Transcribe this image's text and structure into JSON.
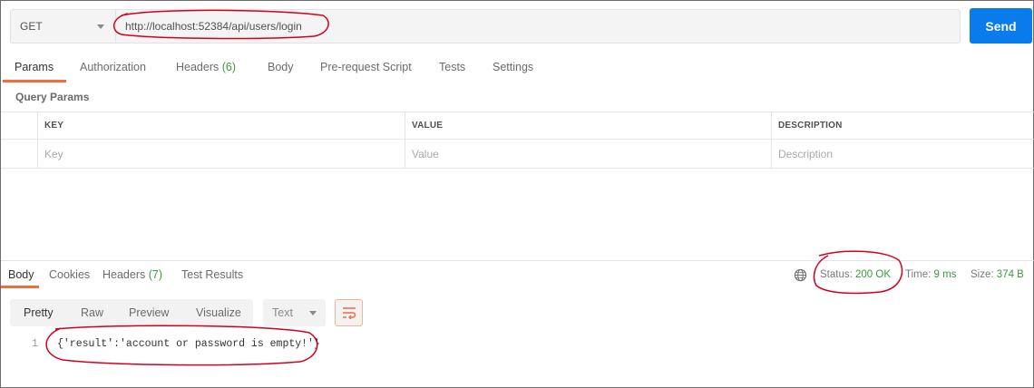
{
  "request": {
    "method": "GET",
    "url": "http://localhost:52384/api/users/login",
    "send_label": "Send"
  },
  "request_tabs": [
    {
      "label": "Params",
      "active": true
    },
    {
      "label": "Authorization"
    },
    {
      "label": "Headers",
      "count": "(6)"
    },
    {
      "label": "Body"
    },
    {
      "label": "Pre-request Script"
    },
    {
      "label": "Tests"
    },
    {
      "label": "Settings"
    }
  ],
  "query_params": {
    "title": "Query Params",
    "columns": [
      "KEY",
      "VALUE",
      "DESCRIPTION"
    ],
    "placeholders": [
      "Key",
      "Value",
      "Description"
    ]
  },
  "response_tabs": [
    {
      "label": "Body",
      "active": true
    },
    {
      "label": "Cookies"
    },
    {
      "label": "Headers",
      "count": "(7)"
    },
    {
      "label": "Test Results"
    }
  ],
  "status": {
    "status_label": "Status:",
    "status_value": "200 OK",
    "time_label": "Time:",
    "time_value": "9 ms",
    "size_label": "Size:",
    "size_value": "374 B"
  },
  "view": {
    "options": [
      "Pretty",
      "Raw",
      "Preview",
      "Visualize"
    ],
    "active": "Pretty",
    "format": "Text"
  },
  "response_body": {
    "line_number": "1",
    "content": "{'result':'account or password is empty!'}"
  },
  "colors": {
    "accent": "#f26b3a",
    "send": "#097bed",
    "ok": "#3d9a3d",
    "annotation": "#d0021b"
  },
  "icons": [
    "chevron-down-icon",
    "globe-icon",
    "wrap-lines-icon"
  ]
}
